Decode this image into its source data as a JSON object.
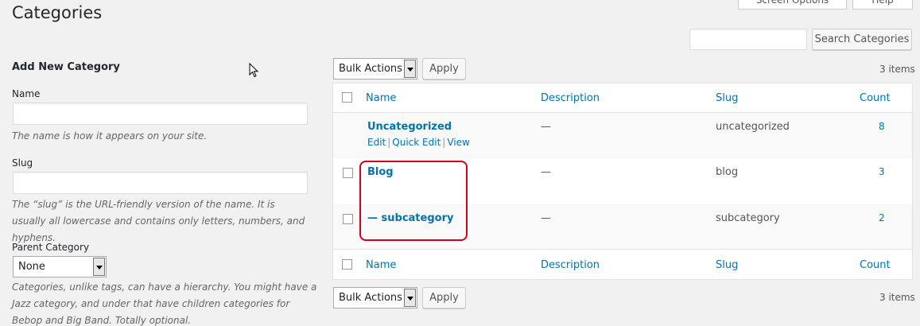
{
  "header": {
    "title": "Categories",
    "screen_options": "Screen Options",
    "help": "Help",
    "search_button": "Search Categories",
    "search_value": ""
  },
  "form": {
    "title": "Add New Category",
    "name_label": "Name",
    "name_value": "",
    "name_desc": "The name is how it appears on your site.",
    "slug_label": "Slug",
    "slug_value": "",
    "slug_desc": "The “slug” is the URL-friendly version of the name. It is usually all lowercase and contains only letters, numbers, and hyphens.",
    "parent_label": "Parent Category",
    "parent_value": "None",
    "parent_desc": "Categories, unlike tags, can have a hierarchy. You might have a Jazz category, and under that have children categories for Bebop and Big Band. Totally optional."
  },
  "tablenav": {
    "bulk_actions": "Bulk Actions",
    "apply": "Apply",
    "items_count": "3 items"
  },
  "table": {
    "columns": {
      "name": "Name",
      "description": "Description",
      "slug": "Slug",
      "count": "Count"
    },
    "rows": [
      {
        "name": "Uncategorized",
        "description": "—",
        "slug": "uncategorized",
        "count": "8",
        "actions": {
          "edit": "Edit",
          "quick_edit": "Quick Edit",
          "view": "View"
        }
      },
      {
        "name": "Blog",
        "description": "—",
        "slug": "blog",
        "count": "3"
      },
      {
        "name": "— subcategory",
        "description": "—",
        "slug": "subcategory",
        "count": "2"
      }
    ]
  },
  "colors": {
    "link": "#0073aa",
    "highlight": "#d0021b"
  }
}
